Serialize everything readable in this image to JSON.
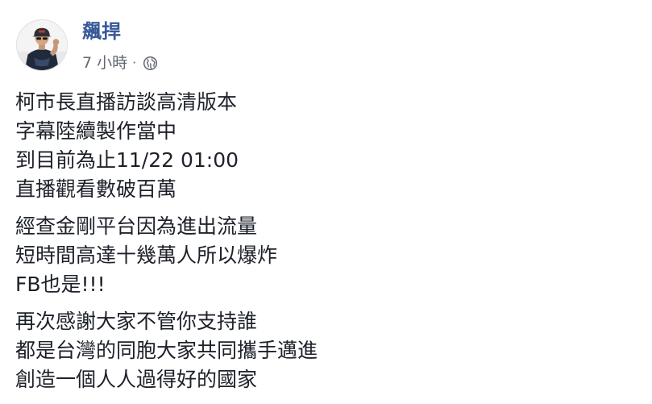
{
  "post": {
    "author": "飆捍",
    "time": "7 小時",
    "separator": "·",
    "privacy_icon": "globe-icon",
    "paragraphs": [
      [
        "柯市長直播訪談高清版本",
        "字幕陸續製作當中",
        "到目前為止11/22 01:00",
        "直播觀看數破百萬"
      ],
      [
        "經查金剛平台因為進出流量",
        "短時間高達十幾萬人所以爆炸",
        "FB也是!!!"
      ],
      [
        "再次感謝大家不管你支持誰",
        "都是台灣的同胞大家共同攜手邁進",
        "創造一個人人過得好的國家"
      ]
    ]
  },
  "colors": {
    "author_link": "#385898",
    "meta_text": "#616770",
    "body_text": "#1d2129"
  }
}
